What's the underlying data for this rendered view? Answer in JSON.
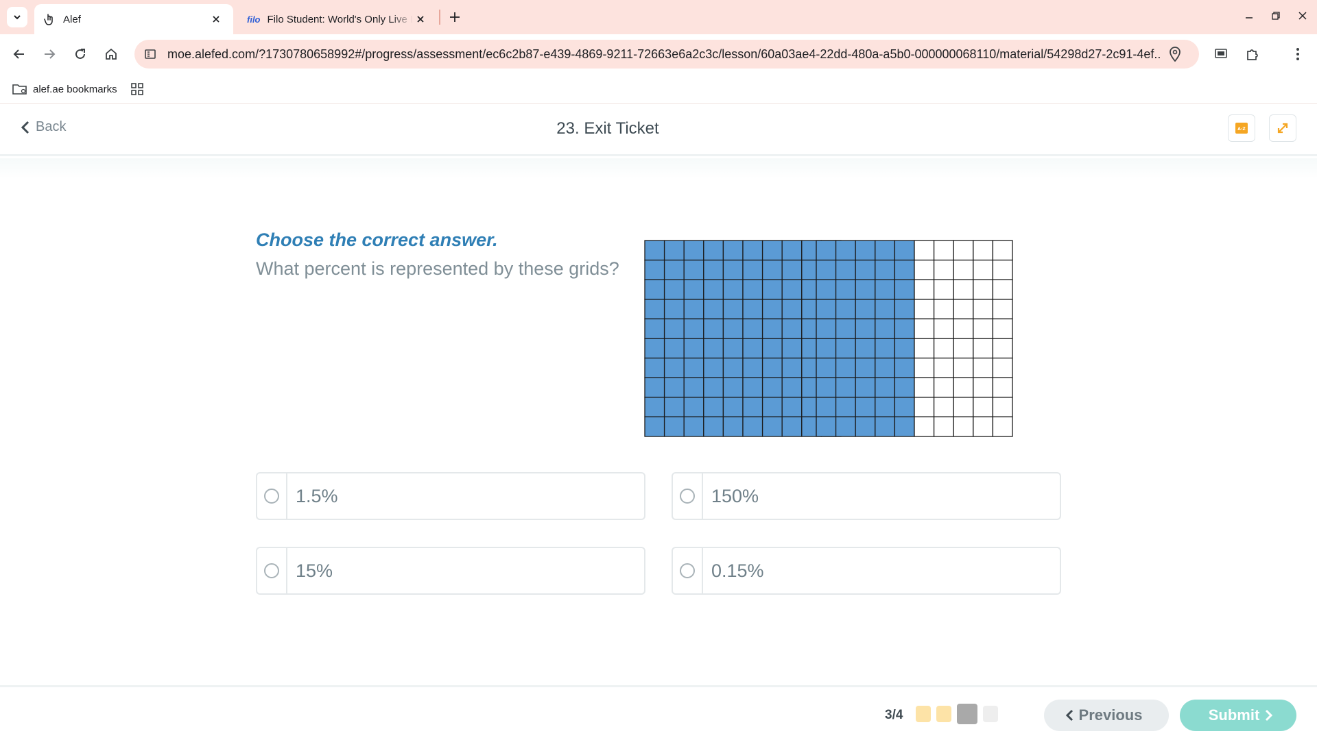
{
  "browser": {
    "tabs": [
      {
        "title": "Alef",
        "favicon": "hand-pointer-icon",
        "active": true
      },
      {
        "title": "Filo Student: World's Only Live Instant Tutoring Platform",
        "favicon_text": "filo",
        "active": false
      }
    ],
    "url": "moe.alefed.com/?1730780658992#/progress/assessment/ec6c2b87-e439-4869-9211-72663e6a2c3c/lesson/60a03ae4-22dd-480a-a5b0-000000068110/material/54298d27-2c91-4ef...",
    "bookmarks": [
      {
        "label": "alef.ae bookmarks"
      }
    ]
  },
  "header": {
    "back_label": "Back",
    "title": "23. Exit Ticket"
  },
  "question": {
    "instruction": "Choose the correct answer.",
    "prompt": "What percent is represented by these grids?",
    "grids": [
      {
        "rows": 10,
        "cols": 10,
        "shaded_columns": 10,
        "fill": "#5b9bd5"
      },
      {
        "rows": 10,
        "cols": 10,
        "shaded_columns": 5,
        "fill": "#5b9bd5"
      }
    ],
    "options": [
      {
        "label": "1.5%"
      },
      {
        "label": "150%"
      },
      {
        "label": "15%"
      },
      {
        "label": "0.15%"
      }
    ]
  },
  "footer": {
    "progress": "3/4",
    "dots": [
      {
        "state": "answered",
        "color": "#fde3a7"
      },
      {
        "state": "answered",
        "color": "#fde3a7"
      },
      {
        "state": "current",
        "color": "#a9a9a9"
      },
      {
        "state": "pending",
        "color": "#eeeeee"
      }
    ],
    "previous_label": "Previous",
    "submit_label": "Submit"
  },
  "colors": {
    "accent_blue": "#2f7fb5",
    "submit_teal": "#8bdbd0",
    "tab_bar": "#fde3de",
    "icon_orange": "#f5a623"
  }
}
